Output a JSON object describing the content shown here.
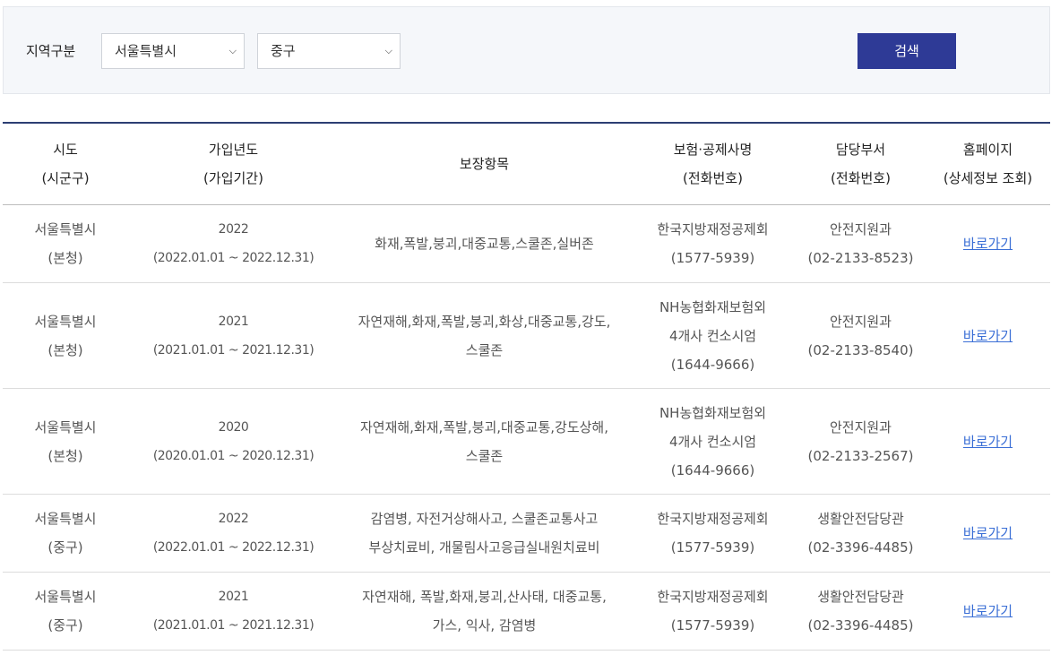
{
  "search": {
    "label": "지역구분",
    "sido_value": "서울특별시",
    "gu_value": "중구",
    "button_label": "검색"
  },
  "table": {
    "headers": {
      "region": [
        "시도",
        "(시군구)"
      ],
      "year": [
        "가입년도",
        "(가입기간)"
      ],
      "coverage": [
        "보장항목"
      ],
      "insurer": [
        "보험·공제사명",
        "(전화번호)"
      ],
      "dept": [
        "담당부서",
        "(전화번호)"
      ],
      "homepage": [
        "홈페이지",
        "(상세정보 조회)"
      ]
    },
    "rows": [
      {
        "region": [
          "서울특별시",
          "(본청)"
        ],
        "year": [
          "2022",
          "(2022.01.01 ~ 2022.12.31)"
        ],
        "coverage": [
          "화재,폭발,붕괴,대중교통,스쿨존,실버존"
        ],
        "insurer": [
          "한국지방재정공제회",
          "(1577-5939)"
        ],
        "dept": [
          "안전지원과",
          "(02-2133-8523)"
        ],
        "link": "바로가기"
      },
      {
        "region": [
          "서울특별시",
          "(본청)"
        ],
        "year": [
          "2021",
          "(2021.01.01 ~ 2021.12.31)"
        ],
        "coverage": [
          "자연재해,화재,폭발,붕괴,화상,대중교통,강도,",
          "스쿨존"
        ],
        "insurer": [
          "NH농협화재보험외",
          "4개사 컨소시엄",
          "(1644-9666)"
        ],
        "dept": [
          "안전지원과",
          "(02-2133-8540)"
        ],
        "link": "바로가기"
      },
      {
        "region": [
          "서울특별시",
          "(본청)"
        ],
        "year": [
          "2020",
          "(2020.01.01 ~ 2020.12.31)"
        ],
        "coverage": [
          "자연재해,화재,폭발,붕괴,대중교통,강도상해,",
          "스쿨존"
        ],
        "insurer": [
          "NH농협화재보험외",
          "4개사 컨소시엄",
          "(1644-9666)"
        ],
        "dept": [
          "안전지원과",
          "(02-2133-2567)"
        ],
        "link": "바로가기"
      },
      {
        "region": [
          "서울특별시",
          "(중구)"
        ],
        "year": [
          "2022",
          "(2022.01.01 ~ 2022.12.31)"
        ],
        "coverage": [
          "감염병, 자전거상해사고, 스쿨존교통사고",
          "부상치료비, 개물림사고응급실내원치료비"
        ],
        "insurer": [
          "한국지방재정공제회",
          "(1577-5939)"
        ],
        "dept": [
          "생활안전담당관",
          "(02-3396-4485)"
        ],
        "link": "바로가기"
      },
      {
        "region": [
          "서울특별시",
          "(중구)"
        ],
        "year": [
          "2021",
          "(2021.01.01 ~ 2021.12.31)"
        ],
        "coverage": [
          "자연재해, 폭발,화재,붕괴,산사태, 대중교통,",
          "가스, 익사, 감염병"
        ],
        "insurer": [
          "한국지방재정공제회",
          "(1577-5939)"
        ],
        "dept": [
          "생활안전담당관",
          "(02-3396-4485)"
        ],
        "link": "바로가기"
      }
    ]
  }
}
